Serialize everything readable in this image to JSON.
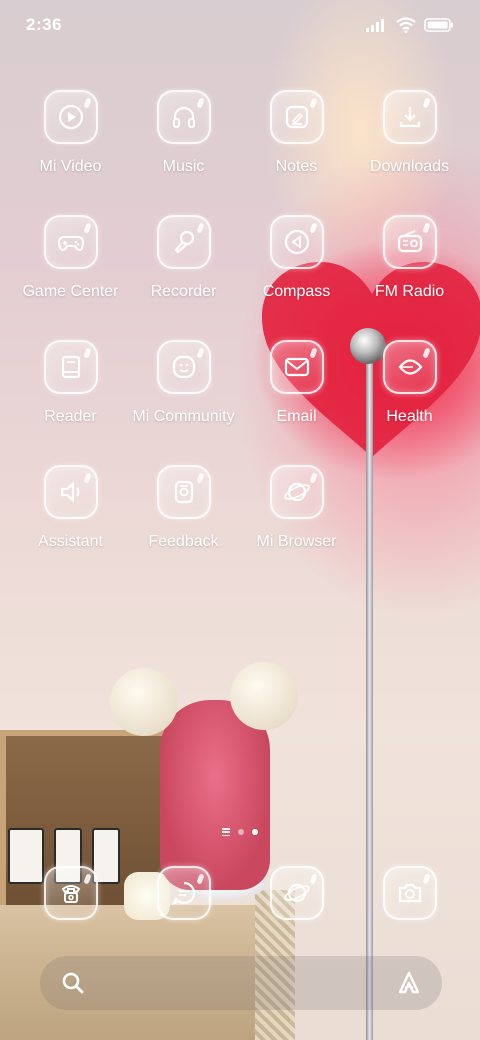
{
  "status_bar": {
    "time": "2:36",
    "icons": [
      "signal-icon",
      "wifi-icon",
      "battery-icon"
    ]
  },
  "apps": [
    {
      "label": "Mi Video",
      "icon": "play-icon"
    },
    {
      "label": "Music",
      "icon": "headphones-icon"
    },
    {
      "label": "Notes",
      "icon": "pencil-icon"
    },
    {
      "label": "Downloads",
      "icon": "download-icon"
    },
    {
      "label": "Game Center",
      "icon": "gamepad-icon"
    },
    {
      "label": "Recorder",
      "icon": "microphone-icon"
    },
    {
      "label": "Compass",
      "icon": "compass-icon"
    },
    {
      "label": "FM Radio",
      "icon": "radio-icon"
    },
    {
      "label": "Reader",
      "icon": "book-icon"
    },
    {
      "label": "Mi Community",
      "icon": "smiley-icon"
    },
    {
      "label": "Email",
      "icon": "envelope-icon"
    },
    {
      "label": "Health",
      "icon": "leaf-icon"
    },
    {
      "label": "Assistant",
      "icon": "speaker-icon"
    },
    {
      "label": "Feedback",
      "icon": "feedback-icon"
    },
    {
      "label": "Mi Browser",
      "icon": "planet-icon"
    }
  ],
  "page_indicator": {
    "pages": 2,
    "active_page": 2
  },
  "dock": [
    {
      "icon": "phone-icon"
    },
    {
      "icon": "message-icon"
    },
    {
      "icon": "planet-icon"
    },
    {
      "icon": "camera-icon"
    }
  ],
  "search_bar": {
    "left_icon": "search-icon",
    "right_icon": "assistant-a-icon"
  },
  "colors": {
    "icon_stroke": "#ffffff",
    "label": "#ffffff",
    "heart": "#e8203c"
  }
}
